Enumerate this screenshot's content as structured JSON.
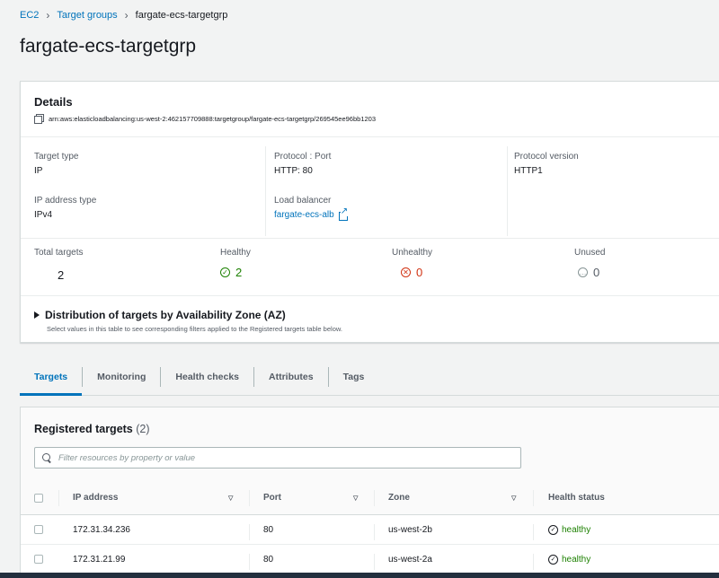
{
  "breadcrumb": {
    "root": "EC2",
    "parent": "Target groups",
    "current": "fargate-ecs-targetgrp"
  },
  "page_title": "fargate-ecs-targetgrp",
  "details": {
    "title": "Details",
    "arn": "arn:aws:elasticloadbalancing:us-west-2:462157709888:targetgroup/fargate-ecs-targetgrp/269545ee96bb1203",
    "target_type_label": "Target type",
    "target_type_value": "IP",
    "protocol_port_label": "Protocol : Port",
    "protocol_port_value": "HTTP: 80",
    "protocol_version_label": "Protocol version",
    "protocol_version_value": "HTTP1",
    "ip_address_type_label": "IP address type",
    "ip_address_type_value": "IPv4",
    "load_balancer_label": "Load balancer",
    "load_balancer_value": "fargate-ecs-alb"
  },
  "counts": {
    "total_label": "Total targets",
    "total_value": "2",
    "healthy_label": "Healthy",
    "healthy_value": "2",
    "unhealthy_label": "Unhealthy",
    "unhealthy_value": "0",
    "unused_label": "Unused",
    "unused_value": "0"
  },
  "az": {
    "title": "Distribution of targets by Availability Zone (AZ)",
    "description": "Select values in this table to see corresponding filters applied to the Registered targets table below."
  },
  "tabs": [
    "Targets",
    "Monitoring",
    "Health checks",
    "Attributes",
    "Tags"
  ],
  "registered": {
    "title": "Registered targets",
    "count": "(2)",
    "search_placeholder": "Filter resources by property or value",
    "columns": {
      "ip": "IP address",
      "port": "Port",
      "zone": "Zone",
      "health": "Health status"
    },
    "rows": [
      {
        "ip": "172.31.34.236",
        "port": "80",
        "zone": "us-west-2b",
        "health": "healthy"
      },
      {
        "ip": "172.31.21.99",
        "port": "80",
        "zone": "us-west-2a",
        "health": "healthy"
      }
    ]
  },
  "colors": {
    "accent": "#0073bb",
    "healthy": "#1d8102",
    "unhealthy": "#d13212",
    "neutral": "#879596"
  }
}
